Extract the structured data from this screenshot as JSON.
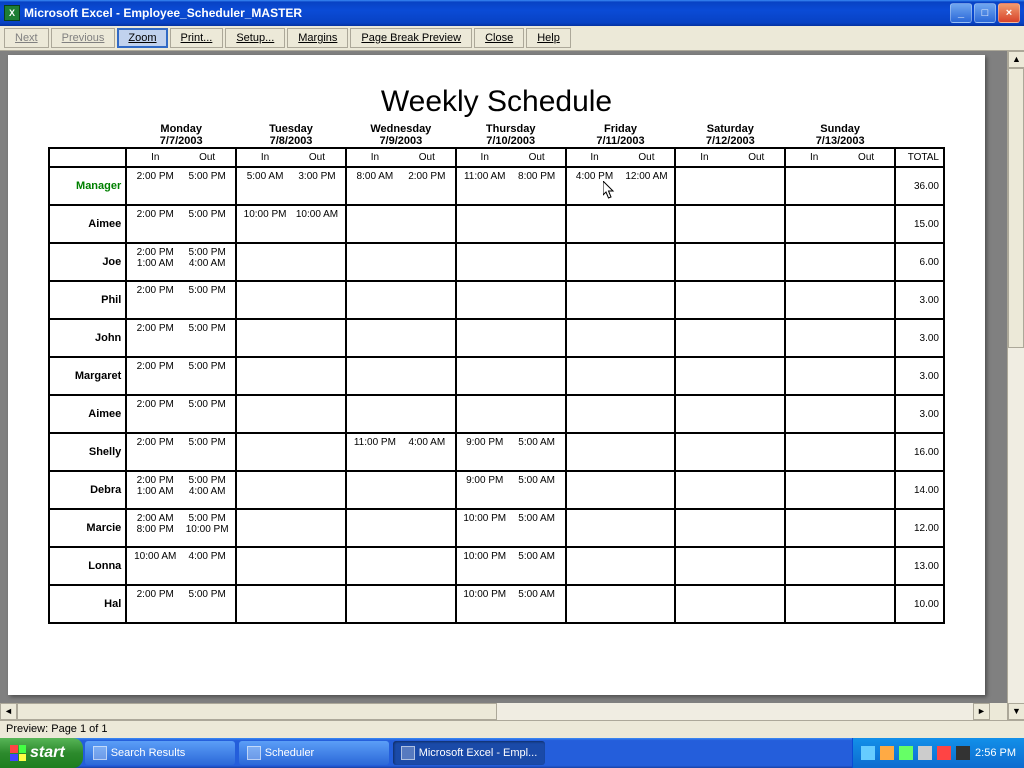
{
  "window": {
    "title": "Microsoft Excel - Employee_Scheduler_MASTER"
  },
  "toolbar": {
    "next": "Next",
    "previous": "Previous",
    "zoom": "Zoom",
    "print": "Print...",
    "setup": "Setup...",
    "margins": "Margins",
    "page_break": "Page Break Preview",
    "close": "Close",
    "help": "Help"
  },
  "document": {
    "title": "Weekly Schedule",
    "days": [
      {
        "name": "Monday",
        "date": "7/7/2003"
      },
      {
        "name": "Tuesday",
        "date": "7/8/2003"
      },
      {
        "name": "Wednesday",
        "date": "7/9/2003"
      },
      {
        "name": "Thursday",
        "date": "7/10/2003"
      },
      {
        "name": "Friday",
        "date": "7/11/2003"
      },
      {
        "name": "Saturday",
        "date": "7/12/2003"
      },
      {
        "name": "Sunday",
        "date": "7/13/2003"
      }
    ],
    "in_label": "In",
    "out_label": "Out",
    "total_label": "TOTAL",
    "rows": [
      {
        "name": "Manager",
        "manager": true,
        "total": "36.00",
        "shifts": [
          [
            [
              "2:00 PM",
              "5:00 PM"
            ]
          ],
          [
            [
              "5:00 AM",
              "3:00 PM"
            ]
          ],
          [
            [
              "8:00 AM",
              "2:00 PM"
            ]
          ],
          [
            [
              "11:00 AM",
              "8:00 PM"
            ]
          ],
          [
            [
              "4:00 PM",
              "12:00 AM"
            ]
          ],
          [],
          []
        ]
      },
      {
        "name": "Aimee",
        "total": "15.00",
        "shifts": [
          [
            [
              "2:00 PM",
              "5:00 PM"
            ]
          ],
          [
            [
              "10:00 PM",
              "10:00 AM"
            ]
          ],
          [],
          [],
          [],
          [],
          []
        ]
      },
      {
        "name": "Joe",
        "total": "6.00",
        "shifts": [
          [
            [
              "2:00 PM",
              "5:00 PM"
            ],
            [
              "1:00 AM",
              "4:00 AM"
            ]
          ],
          [],
          [],
          [],
          [],
          [],
          []
        ]
      },
      {
        "name": "Phil",
        "total": "3.00",
        "shifts": [
          [
            [
              "2:00 PM",
              "5:00 PM"
            ]
          ],
          [],
          [],
          [],
          [],
          [],
          []
        ]
      },
      {
        "name": "John",
        "total": "3.00",
        "shifts": [
          [
            [
              "2:00 PM",
              "5:00 PM"
            ]
          ],
          [],
          [],
          [],
          [],
          [],
          []
        ]
      },
      {
        "name": "Margaret",
        "total": "3.00",
        "shifts": [
          [
            [
              "2:00 PM",
              "5:00 PM"
            ]
          ],
          [],
          [],
          [],
          [],
          [],
          []
        ]
      },
      {
        "name": "Aimee",
        "total": "3.00",
        "shifts": [
          [
            [
              "2:00 PM",
              "5:00 PM"
            ]
          ],
          [],
          [],
          [],
          [],
          [],
          []
        ]
      },
      {
        "name": "Shelly",
        "total": "16.00",
        "shifts": [
          [
            [
              "2:00 PM",
              "5:00 PM"
            ]
          ],
          [],
          [
            [
              "11:00 PM",
              "4:00 AM"
            ]
          ],
          [
            [
              "9:00 PM",
              "5:00 AM"
            ]
          ],
          [],
          [],
          []
        ]
      },
      {
        "name": "Debra",
        "total": "14.00",
        "shifts": [
          [
            [
              "2:00 PM",
              "5:00 PM"
            ],
            [
              "1:00 AM",
              "4:00 AM"
            ]
          ],
          [],
          [],
          [
            [
              "9:00 PM",
              "5:00 AM"
            ]
          ],
          [],
          [],
          []
        ]
      },
      {
        "name": "Marcie",
        "total": "12.00",
        "shifts": [
          [
            [
              "2:00 AM",
              "5:00 PM"
            ],
            [
              "8:00 PM",
              "10:00 PM"
            ]
          ],
          [],
          [],
          [
            [
              "10:00 PM",
              "5:00 AM"
            ]
          ],
          [],
          [],
          []
        ]
      },
      {
        "name": "Lonna",
        "total": "13.00",
        "shifts": [
          [
            [
              "10:00 AM",
              "4:00 PM"
            ]
          ],
          [],
          [],
          [
            [
              "10:00 PM",
              "5:00 AM"
            ]
          ],
          [],
          [],
          []
        ]
      },
      {
        "name": "Hal",
        "total": "10.00",
        "shifts": [
          [
            [
              "2:00 PM",
              "5:00 PM"
            ]
          ],
          [],
          [],
          [
            [
              "10:00 PM",
              "5:00 AM"
            ]
          ],
          [],
          [],
          []
        ]
      }
    ]
  },
  "status": {
    "text": "Preview: Page 1 of 1"
  },
  "taskbar": {
    "start": "start",
    "items": [
      {
        "label": "Search Results",
        "active": false
      },
      {
        "label": "Scheduler",
        "active": false
      },
      {
        "label": "Microsoft Excel - Empl...",
        "active": true
      }
    ],
    "clock": "2:56 PM"
  }
}
